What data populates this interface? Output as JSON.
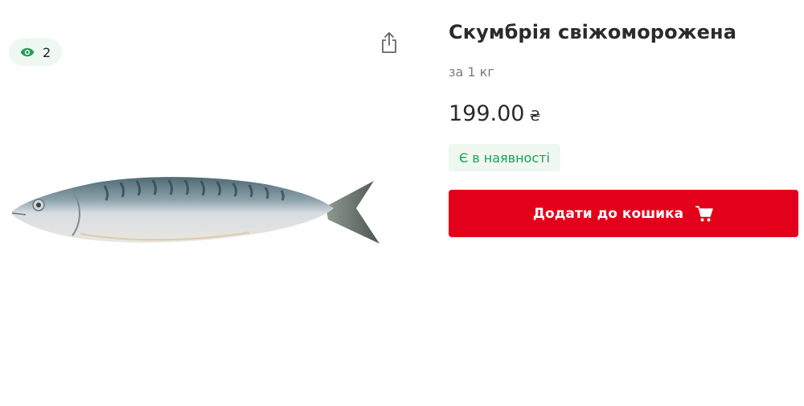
{
  "views": {
    "count": "2",
    "icon": "eye-icon"
  },
  "share": {
    "icon": "share-icon"
  },
  "product": {
    "image_icon": "mackerel-fish-image",
    "title": "Скумбрія свіжоморожена",
    "unit": "за 1 кг",
    "price": "199.00",
    "currency": "₴",
    "stock_status": "Є в наявності",
    "add_to_cart_label": "Додати до кошика",
    "cart_icon": "cart-icon"
  },
  "colors": {
    "accent_red": "#e3001b",
    "stock_green": "#1f9d55",
    "badge_bg": "#eef7f0"
  }
}
